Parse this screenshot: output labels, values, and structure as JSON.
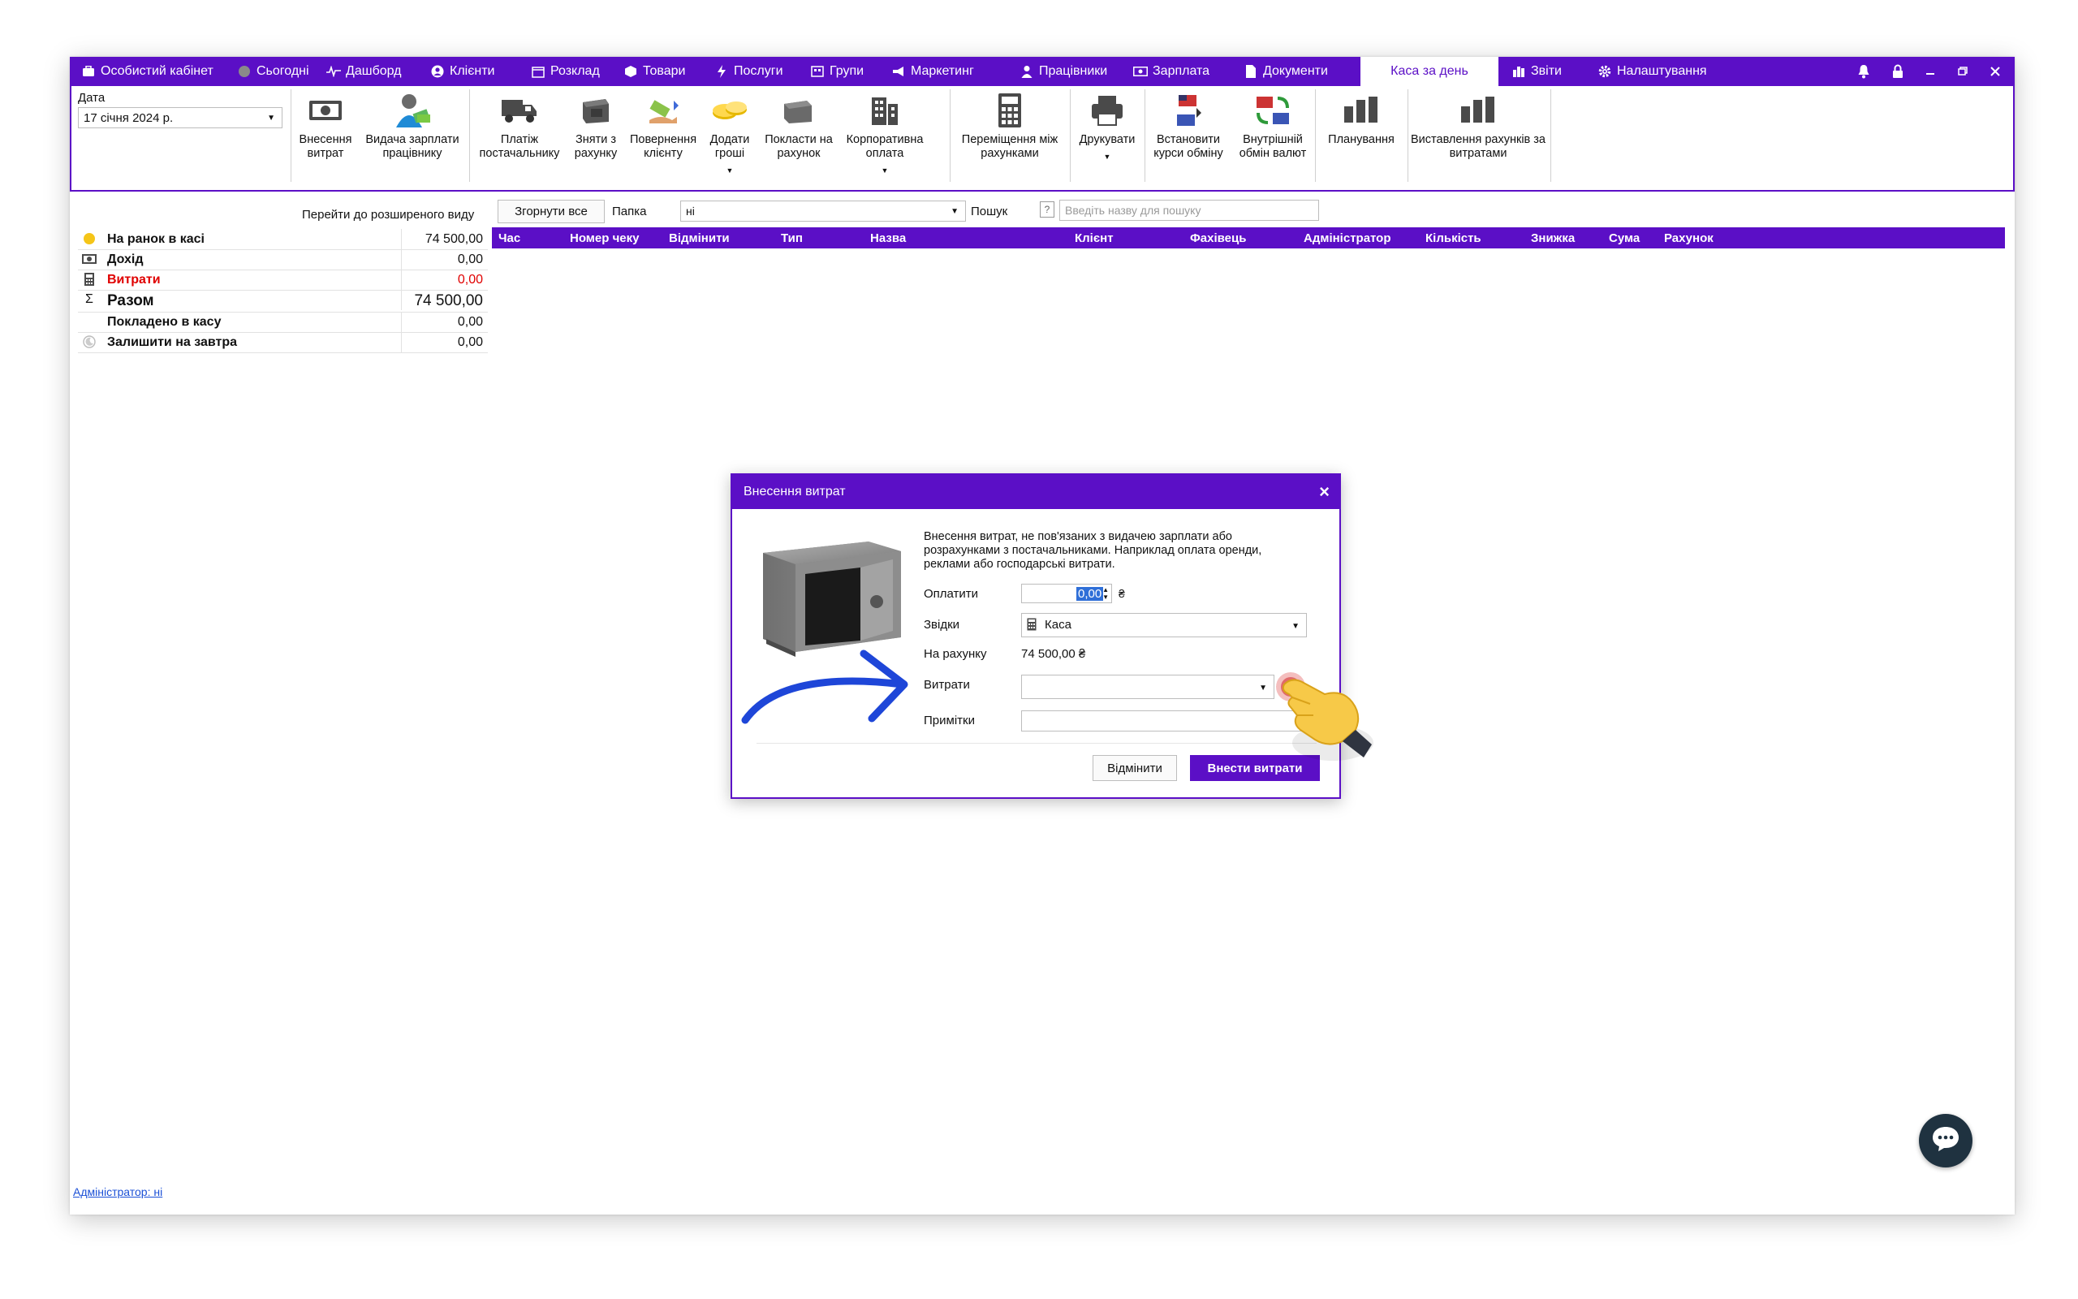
{
  "menu": {
    "items": [
      {
        "label": "Особистий кабінет",
        "icon": "briefcase-icon"
      },
      {
        "label": "Сьогодні",
        "icon": "clock-icon"
      },
      {
        "label": "Дашборд",
        "icon": "pulse-icon"
      },
      {
        "label": "Клієнти",
        "icon": "user-circle-icon"
      },
      {
        "label": "Розклад",
        "icon": "calendar-icon"
      },
      {
        "label": "Товари",
        "icon": "box-icon"
      },
      {
        "label": "Послуги",
        "icon": "lightning-icon"
      },
      {
        "label": "Групи",
        "icon": "group-icon"
      },
      {
        "label": "Маркетинг",
        "icon": "megaphone-icon"
      },
      {
        "label": "Працівники",
        "icon": "person-icon"
      },
      {
        "label": "Зарплата",
        "icon": "money-icon"
      },
      {
        "label": "Документи",
        "icon": "document-icon"
      },
      {
        "label": "Каса за день",
        "icon": ""
      },
      {
        "label": "Звіти",
        "icon": "bar-chart-icon"
      },
      {
        "label": "Налаштування",
        "icon": "gear-icon"
      }
    ],
    "active_index": 12,
    "accent": "#5b0fc6"
  },
  "ribbon": {
    "date_label": "Дата",
    "date_value": "17 січня 2024 р.",
    "buttons": [
      {
        "label": "Внесення витрат",
        "icon": "cash-icon"
      },
      {
        "label": "Видача зарплати працівнику",
        "icon": "salary-person-icon"
      },
      {
        "label": "Платіж постачальнику",
        "icon": "truck-icon"
      },
      {
        "label": "Зняти з рахунку",
        "icon": "withdraw-icon"
      },
      {
        "label": "Повернення клієнту",
        "icon": "refund-icon"
      },
      {
        "label": "Додати гроші",
        "icon": "coins-icon"
      },
      {
        "label": "Покласти на рахунок",
        "icon": "deposit-icon"
      },
      {
        "label": "Корпоративна оплата",
        "icon": "building-icon"
      },
      {
        "label": "Переміщення між рахунками",
        "icon": "calculator-icon"
      },
      {
        "label": "Друкувати",
        "icon": "printer-icon"
      },
      {
        "label": "Встановити курси обміну",
        "icon": "exchange-rate-icon"
      },
      {
        "label": "Внутрішній обмін валют",
        "icon": "currency-exchange-icon"
      },
      {
        "label": "Планування",
        "icon": "chart-bars-icon"
      },
      {
        "label": "Виставлення рахунків за витратами",
        "icon": "chart-bars-icon"
      }
    ]
  },
  "summary": {
    "advanced_link": "Перейти до розширеного виду",
    "rows": [
      {
        "label": "На ранок в касі",
        "value": "74 500,00",
        "icon": "coin-icon"
      },
      {
        "label": "Дохід",
        "value": "0,00",
        "icon": "cash-icon"
      },
      {
        "label": "Витрати",
        "value": "0,00",
        "icon": "calculator-icon"
      },
      {
        "label": "Разом",
        "value": "74 500,00",
        "icon": "sigma-icon"
      },
      {
        "label": "Покладено в касу",
        "value": "0,00",
        "icon": ""
      },
      {
        "label": "Залишити на завтра",
        "value": "0,00",
        "icon": "moon-icon"
      }
    ],
    "expense_color": "#e00000"
  },
  "filters": {
    "collapse_label": "Згорнути все",
    "folder_label": "Папка",
    "folder_value": "ні",
    "search_label": "Пошук",
    "help_label": "?",
    "search_placeholder": "Введіть назву для пошуку"
  },
  "grid": {
    "columns": [
      "Час",
      "Номер чеку",
      "Відмінити",
      "Тип",
      "Назва",
      "Клієнт",
      "Фахівець",
      "Адміністратор",
      "Кількість",
      "Знижка",
      "Сума",
      "Рахунок"
    ]
  },
  "footer": {
    "admin_link": "Адміністратор: ні"
  },
  "dialog": {
    "title": "Внесення витрат",
    "description": "Внесення витрат, не пов'язаних з видачею зарплати або розрахунками з постачальниками. Наприклад оплата оренди, реклами або господарські витрати.",
    "pay_label": "Оплатити",
    "pay_value": "0,00",
    "currency": "₴",
    "from_label": "Звідки",
    "from_value": "Каса",
    "balance_label": "На рахунку",
    "balance_value": "74 500,00 ₴",
    "expense_label": "Витрати",
    "notes_label": "Примітки",
    "cancel_label": "Відмінити",
    "submit_label": "Внести витрати"
  }
}
